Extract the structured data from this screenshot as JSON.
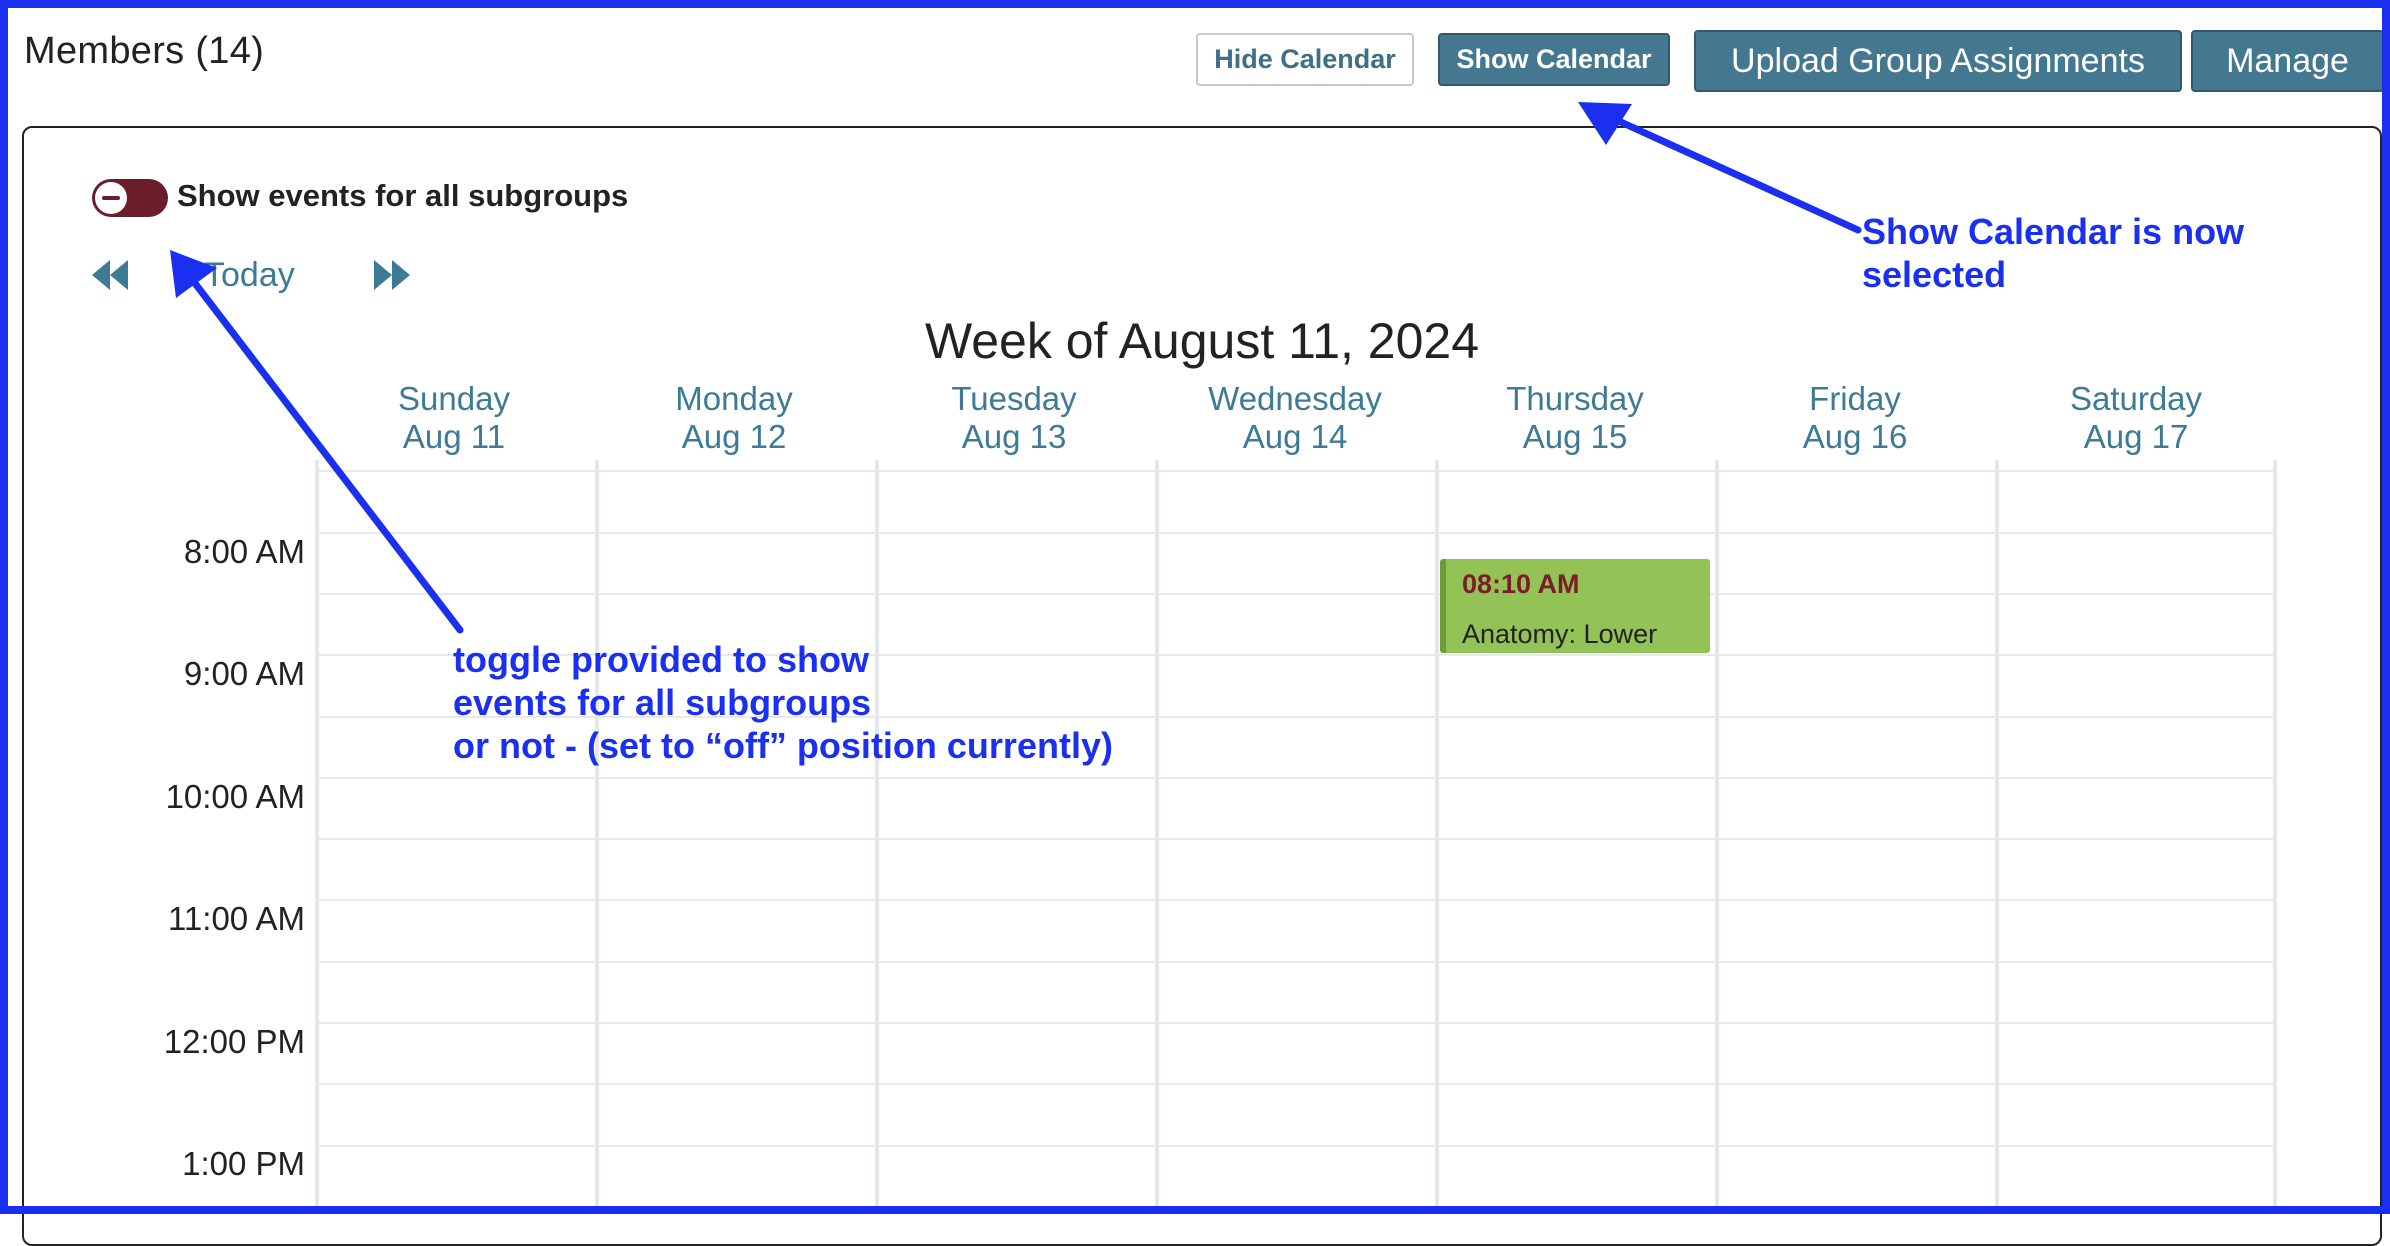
{
  "header": {
    "members_title": "Members (14)",
    "hide_calendar_label": "Hide Calendar",
    "show_calendar_label": "Show Calendar",
    "upload_label": "Upload Group Assignments",
    "manage_label": "Manage"
  },
  "calendar": {
    "toggle_label": "Show events for all subgroups",
    "toggle_state": "off",
    "nav": {
      "today_label": "Today",
      "prev_icon": "double-left-arrow-icon",
      "next_icon": "double-right-arrow-icon"
    },
    "week_title": "Week of August 11, 2024",
    "days": [
      {
        "name": "Sunday",
        "date": "Aug 11"
      },
      {
        "name": "Monday",
        "date": "Aug 12"
      },
      {
        "name": "Tuesday",
        "date": "Aug 13"
      },
      {
        "name": "Wednesday",
        "date": "Aug 14"
      },
      {
        "name": "Thursday",
        "date": "Aug 15"
      },
      {
        "name": "Friday",
        "date": "Aug 16"
      },
      {
        "name": "Saturday",
        "date": "Aug 17"
      }
    ],
    "times": [
      "8:00 AM",
      "9:00 AM",
      "10:00 AM",
      "11:00 AM",
      "12:00 PM",
      "1:00 PM"
    ],
    "events": [
      {
        "day": "Thursday",
        "time": "08:10 AM",
        "title": "Anatomy: Lower"
      }
    ]
  },
  "annotations": {
    "show_calendar_note": [
      "Show Calendar is now",
      "selected"
    ],
    "toggle_note": [
      "toggle provided to show",
      "events for all subgroups",
      "or not - (set to “off” position currently)"
    ]
  },
  "colors": {
    "annotation_blue": "#1a2ff0",
    "button_teal": "#447891",
    "link_teal": "#3d7a95",
    "toggle_off": "#6b1e2a",
    "event_green": "#93c256"
  }
}
